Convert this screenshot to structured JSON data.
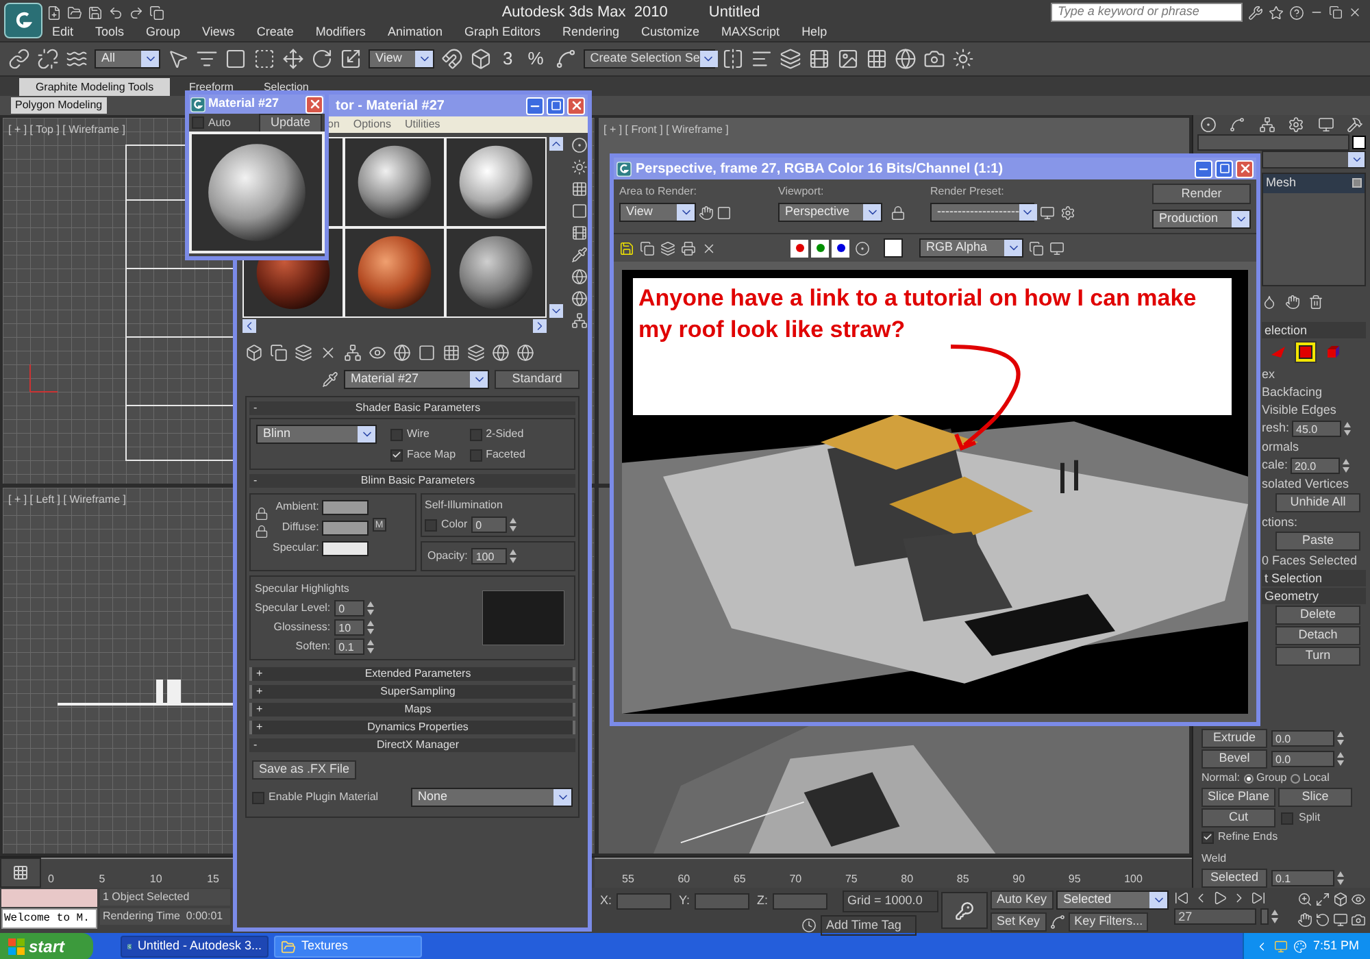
{
  "app": {
    "title": "Autodesk 3ds Max  2010",
    "document": "Untitled",
    "search_placeholder": "Type a keyword or phrase"
  },
  "menu": [
    "Edit",
    "Tools",
    "Group",
    "Views",
    "Create",
    "Modifiers",
    "Animation",
    "Graph Editors",
    "Rendering",
    "Customize",
    "MAXScript",
    "Help"
  ],
  "toolbar": {
    "selection_filter": "All",
    "coordinate_system": "View",
    "snap_labels": [
      "3",
      "%"
    ],
    "named_selection": "Create Selection Se"
  },
  "ribbon": {
    "tabs": [
      {
        "label": "Graphite Modeling Tools",
        "selected": true
      },
      {
        "label": "Freeform",
        "selected": false
      },
      {
        "label": "Selection",
        "selected": false
      }
    ],
    "panel": "Polygon Modeling"
  },
  "viewports": [
    {
      "label": "[ + ] [ Top ] [ Wireframe ]"
    },
    {
      "label": "[ + ] [ Front ] [ Wireframe ]"
    },
    {
      "label": "[ + ] [ Left ] [ Wireframe ]"
    }
  ],
  "material_preview": {
    "title": "Material #27",
    "auto_label": "Auto",
    "auto": false,
    "update": "Update"
  },
  "material_editor": {
    "title": "tor - Material #27",
    "menu": [
      "on",
      "Options",
      "Utilities"
    ],
    "material_name": "Material #27",
    "material_type": "Standard",
    "rollouts": [
      {
        "kind": "shader",
        "title": "Shader Basic Parameters",
        "sign": "-",
        "expanded": true,
        "shader": "Blinn",
        "options": [
          {
            "label": "Wire",
            "checked": false
          },
          {
            "label": "2-Sided",
            "checked": false
          },
          {
            "label": "Face Map",
            "checked": true
          },
          {
            "label": "Faceted",
            "checked": false
          }
        ]
      },
      {
        "kind": "basic",
        "title": "Blinn Basic Parameters",
        "sign": "-",
        "expanded": true,
        "colors": [
          {
            "label": "Ambient:",
            "color": "#9a9a9a"
          },
          {
            "label": "Diffuse:",
            "color": "#9a9a9a"
          },
          {
            "label": "Specular:",
            "color": "#e8e8e8"
          }
        ],
        "map_button": "M",
        "self_illumination": {
          "title": "Self-Illumination",
          "label": "Color",
          "checked": false,
          "value": "0"
        },
        "opacity": {
          "label": "Opacity:",
          "value": "100"
        },
        "highlights": {
          "title": "Specular Highlights",
          "fields": [
            {
              "label": "Specular Level:",
              "value": "0"
            },
            {
              "label": "Glossiness:",
              "value": "10"
            },
            {
              "label": "Soften:",
              "value": "0.1"
            }
          ]
        }
      },
      {
        "title": "Extended Parameters",
        "sign": "+",
        "expanded": false
      },
      {
        "title": "SuperSampling",
        "sign": "+",
        "expanded": false
      },
      {
        "title": "Maps",
        "sign": "+",
        "expanded": false
      },
      {
        "title": "Dynamics Properties",
        "sign": "+",
        "expanded": false
      },
      {
        "kind": "directx",
        "title": "DirectX Manager",
        "sign": "-",
        "expanded": true,
        "save_button": "Save as .FX File",
        "plugin_label": "Enable Plugin Material",
        "plugin_checked": false,
        "plugin_value": "None"
      }
    ]
  },
  "render_window": {
    "title": "Perspective, frame 27, RGBA Color 16 Bits/Channel (1:1)",
    "area_label": "Area to Render:",
    "area": "View",
    "viewport_label": "Viewport:",
    "viewport": "Perspective",
    "preset_label": "Render Preset:",
    "preset": "--------------------",
    "render_button": "Render",
    "mode": "Production",
    "channels": [
      {
        "color": "#e00000",
        "on": true
      },
      {
        "color": "#008f00",
        "on": true
      },
      {
        "color": "#0000e0",
        "on": true
      }
    ],
    "display": "RGB Alpha",
    "annotation": "Anyone have a link to a tutorial on how I can make my roof look like straw?"
  },
  "command_panel": {
    "modifier": "Mesh",
    "rows": [
      {
        "kind": "header",
        "text": "election"
      },
      {
        "kind": "levels",
        "levels": [
          {
            "selected": false
          },
          {
            "selected": true
          },
          {
            "selected": false
          }
        ]
      },
      {
        "kind": "text",
        "text": "ex"
      },
      {
        "kind": "text",
        "text": "Backfacing"
      },
      {
        "kind": "text",
        "text": "Visible Edges"
      },
      {
        "kind": "spinner",
        "label": "resh:",
        "value": "45.0"
      },
      {
        "kind": "text",
        "text": "ormals"
      },
      {
        "kind": "spinner",
        "label": "cale:",
        "value": "20.0"
      },
      {
        "kind": "text",
        "text": "solated Vertices"
      },
      {
        "kind": "button",
        "text": "Unhide All"
      },
      {
        "kind": "text",
        "text": "ctions:"
      },
      {
        "kind": "button",
        "text": "Paste"
      },
      {
        "kind": "text",
        "text": "0 Faces Selected"
      },
      {
        "kind": "header",
        "text": "t Selection"
      },
      {
        "kind": "header",
        "text": "Geometry"
      },
      {
        "kind": "button",
        "text": "Delete"
      },
      {
        "kind": "button",
        "text": "Detach"
      },
      {
        "kind": "button",
        "text": "Turn"
      }
    ],
    "lower": [
      {
        "kind": "spinner_button",
        "label": "Extrude",
        "value": "0.0"
      },
      {
        "kind": "spinner_button",
        "label": "Bevel",
        "value": "0.0"
      },
      {
        "kind": "radio",
        "label": "Normal:",
        "options": [
          {
            "label": "Group",
            "selected": true
          },
          {
            "label": "Local",
            "selected": false
          }
        ]
      },
      {
        "kind": "pair",
        "buttons": [
          "Slice Plane",
          "Slice"
        ]
      },
      {
        "kind": "cut",
        "button": "Cut",
        "label": "Split",
        "checked": false
      },
      {
        "kind": "check",
        "label": "Refine Ends",
        "checked": true
      },
      {
        "kind": "group",
        "text": "Weld"
      },
      {
        "kind": "spinner_button",
        "label": "Selected",
        "value": "0.1"
      }
    ]
  },
  "timeline": {
    "left_ticks": [
      "0",
      "5",
      "10",
      "15"
    ],
    "right_ticks": [
      "55",
      "60",
      "65",
      "70",
      "75",
      "80",
      "85",
      "90",
      "95",
      "100"
    ]
  },
  "status": {
    "prompt": "Welcome to M.",
    "selection": "1 Object Selected",
    "render_time": "Rendering Time  0:00:01",
    "x_label": "X:",
    "y_label": "Y:",
    "z_label": "Z:",
    "grid": "Grid = 1000.0",
    "time_tag": "Add Time Tag",
    "auto_key": "Auto Key",
    "set_key": "Set Key",
    "key_mode": "Selected",
    "key_filters": "Key Filters...",
    "frame": "27"
  },
  "taskbar": {
    "start": "start",
    "tasks": [
      {
        "label": "Untitled - Autodesk 3...",
        "selected": true
      },
      {
        "label": "Textures",
        "selected": false
      }
    ],
    "clock": "7:51 PM"
  }
}
